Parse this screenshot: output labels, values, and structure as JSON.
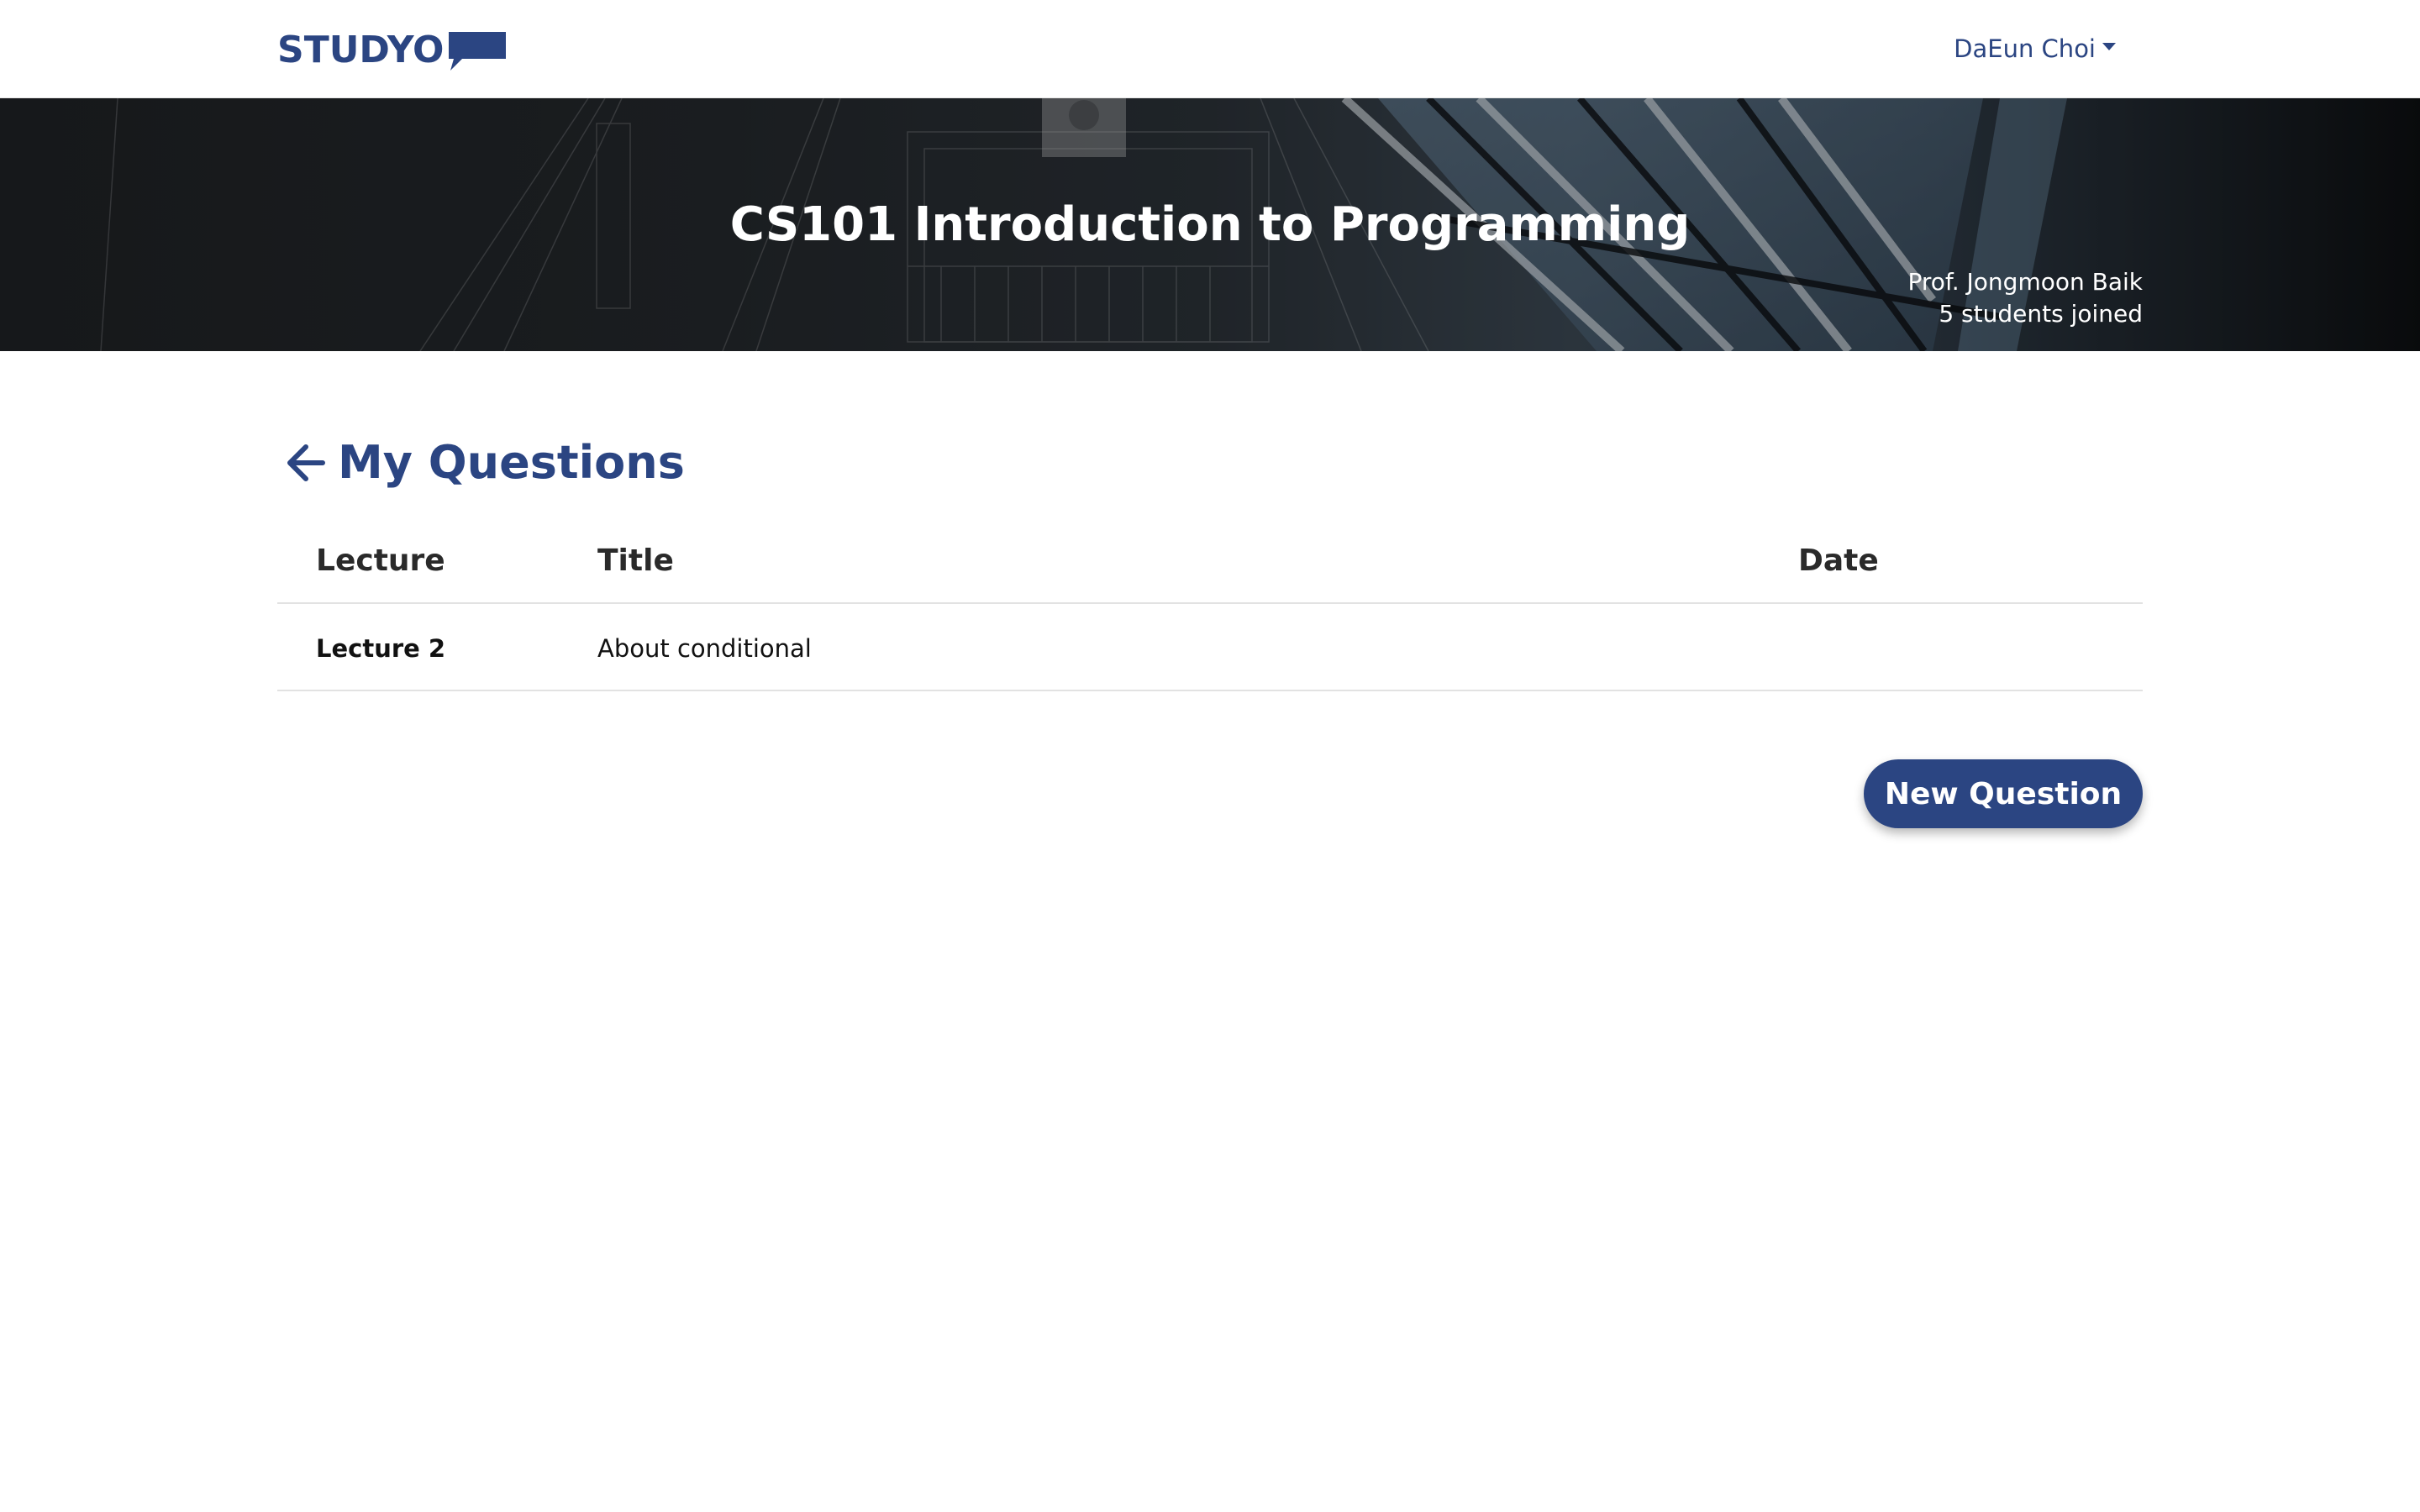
{
  "navbar": {
    "logo_text": "STUDYO",
    "logo_icon": "speech-bubble-icon",
    "user_name": "DaEun Choi",
    "user_menu_icon": "caret-down-icon"
  },
  "banner": {
    "course_title": "CS101 Introduction to Programming",
    "professor": "Prof. Jongmoon Baik",
    "students_joined": "5 students joined"
  },
  "main": {
    "back_icon": "arrow-left-icon",
    "title": "My Questions",
    "table": {
      "headers": {
        "lecture": "Lecture",
        "title": "Title",
        "date": "Date"
      },
      "rows": [
        {
          "lecture": "Lecture 2",
          "title": "About conditional",
          "date": ""
        }
      ]
    },
    "new_question_label": "New Question"
  },
  "colors": {
    "brand": "#2b4582",
    "banner_dark": "#1e2124",
    "text": "#111111",
    "divider": "#e2e2e2"
  }
}
